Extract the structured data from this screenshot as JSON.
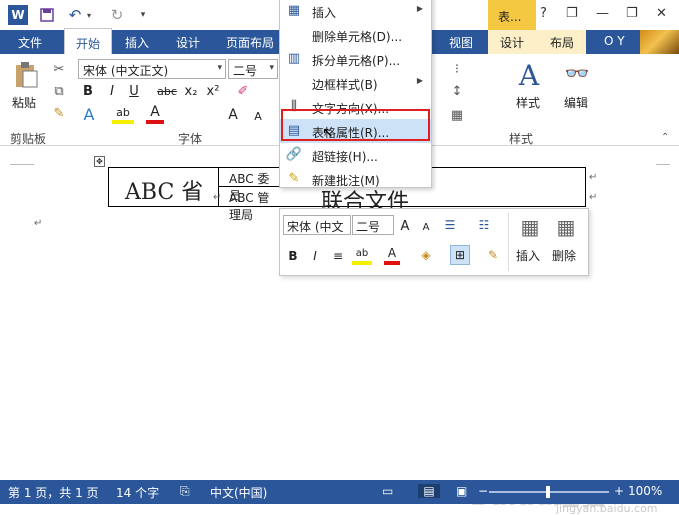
{
  "colors": {
    "accent": "#2b579a",
    "contextual_tab": "#f5c842",
    "highlight": "#e02020",
    "menu_hover": "#cde2f7"
  },
  "quick_access": {
    "app_icon": "W",
    "icons": [
      "word-logo-icon",
      "save-icon",
      "undo-icon",
      "redo-icon",
      "customize-icon"
    ]
  },
  "title": {
    "context_tab": "表...",
    "help": "?",
    "minimize": "—",
    "restore": "❐",
    "close": "✕"
  },
  "tabs": {
    "file": "文件",
    "home": "开始",
    "insert": "插入",
    "design": "设计",
    "layout": "页面布局",
    "view": "视图",
    "table_design": "设计",
    "table_layout": "布局",
    "user": "O Y"
  },
  "ribbon": {
    "paste": "粘贴",
    "clipboard": "剪贴板",
    "font_name": "宋体 (中文正文)",
    "font_size": "二号",
    "font": "字体",
    "style": "样式",
    "styles_group": "样式",
    "edit": "编辑",
    "bold": "B",
    "italic": "I",
    "underline": "U",
    "strike": "abc",
    "subscript": "x₂",
    "superscript": "x²",
    "grow_font": "A",
    "shrink_font": "A"
  },
  "context_menu": {
    "items": [
      {
        "label": "插入",
        "icon": "insert-icon",
        "submenu": true
      },
      {
        "label": "删除单元格(D)...",
        "icon": "",
        "submenu": false
      },
      {
        "label": "拆分单元格(P)...",
        "icon": "split-cells-icon",
        "submenu": false
      },
      {
        "label": "边框样式(B)",
        "icon": "",
        "submenu": true
      },
      {
        "label": "文字方向(X)...",
        "icon": "text-direction-icon",
        "submenu": false
      },
      {
        "label": "表格属性(R)...",
        "icon": "table-properties-icon",
        "submenu": false
      },
      {
        "label": "超链接(H)...",
        "icon": "hyperlink-icon",
        "submenu": false
      },
      {
        "label": "新建批注(M)",
        "icon": "new-comment-icon",
        "submenu": false
      }
    ]
  },
  "mini_toolbar": {
    "font_name": "宋体 (中文",
    "font_size": "二号",
    "insert": "插入",
    "delete": "删除"
  },
  "document": {
    "cell_main": "ABC 省",
    "cell_committee": "ABC 委员",
    "cell_admin": "ABC 管理局",
    "title_text": "联合文件",
    "para_mark": "↵"
  },
  "status": {
    "page": "第 1 页，共 1 页",
    "words": "14 个字",
    "language": "中文(中国)",
    "zoom": "100%",
    "zoom_minus": "−",
    "zoom_plus": "+"
  },
  "watermark": {
    "main": "Baidu经验",
    "sub": "jingyan.baidu.com"
  }
}
